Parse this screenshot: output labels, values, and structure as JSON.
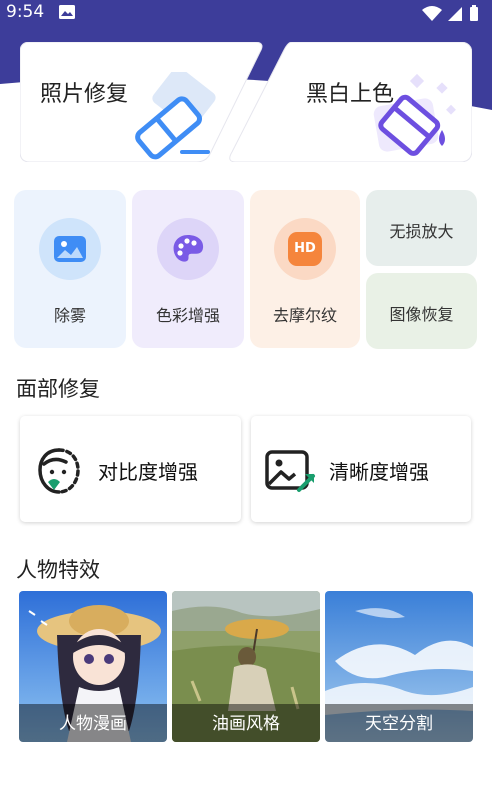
{
  "status_bar": {
    "time": "9:54",
    "icons": [
      "image-notification-icon",
      "wifi-icon",
      "signal-icon",
      "battery-icon"
    ]
  },
  "hero": [
    {
      "label": "照片修复",
      "icon": "eraser-icon"
    },
    {
      "label": "黑白上色",
      "icon": "paint-bucket-icon"
    }
  ],
  "tools": [
    {
      "label": "除雾",
      "icon": "image-icon",
      "bg": "#ecf3fd",
      "circle": "#cfe4fb",
      "accent": "#3f8df5"
    },
    {
      "label": "色彩增强",
      "icon": "palette-icon",
      "bg": "#f0ecfc",
      "circle": "#ddd5f8",
      "accent": "#7a5be6"
    },
    {
      "label": "去摩尔纹",
      "icon": "hd-icon",
      "bg": "#fdf0e6",
      "circle": "#fbd9c4",
      "accent": "#f5853c",
      "badge": "HD"
    },
    {
      "label": "无损放大",
      "bg": "#e7eeec"
    },
    {
      "label": "图像恢复",
      "bg": "#e9f1e6"
    }
  ],
  "face_section": {
    "title": "面部修复",
    "items": [
      {
        "label": "对比度增强",
        "icon": "face-contrast-icon"
      },
      {
        "label": "清晰度增强",
        "icon": "image-enhance-icon"
      }
    ]
  },
  "effects_section": {
    "title": "人物特效",
    "items": [
      {
        "label": "人物漫画"
      },
      {
        "label": "油画风格"
      },
      {
        "label": "天空分割"
      }
    ]
  },
  "colors": {
    "header": "#3d3d9a",
    "accent_green": "#1a9e6e"
  }
}
